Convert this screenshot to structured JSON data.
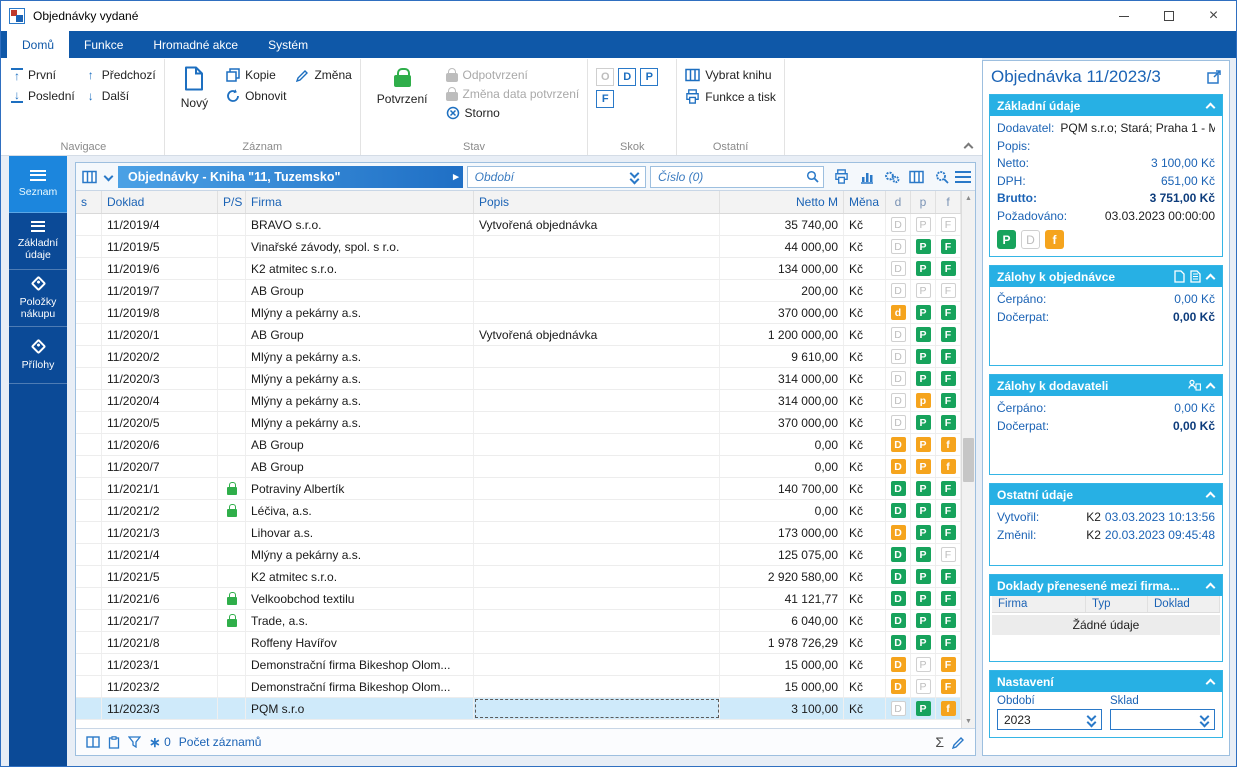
{
  "window": {
    "title": "Objednávky vydané"
  },
  "ribbon": {
    "tabs": [
      "Domů",
      "Funkce",
      "Hromadné akce",
      "Systém"
    ],
    "navigace": {
      "label": "Navigace",
      "prvni": "První",
      "posledni": "Poslední",
      "predchozi": "Předchozí",
      "dalsi": "Další"
    },
    "zaznam": {
      "label": "Záznam",
      "novy": "Nový",
      "kopie": "Kopie",
      "obnovit": "Obnovit",
      "zmena": "Změna"
    },
    "stav": {
      "label": "Stav",
      "potvrzeni": "Potvrzení",
      "odpotvrzeni": "Odpotvrzení",
      "zmena_data": "Změna data potvrzení",
      "storno": "Storno"
    },
    "skok": {
      "label": "Skok",
      "o": "O",
      "d": "D",
      "p": "P",
      "f": "F"
    },
    "ostatni": {
      "label": "Ostatní",
      "vybrat_knihu": "Vybrat knihu",
      "funkce_a_tisk": "Funkce a tisk"
    }
  },
  "sidebar": {
    "items": [
      {
        "label": "Seznam",
        "active": true
      },
      {
        "label": "Základní údaje"
      },
      {
        "label": "Položky nákupu"
      },
      {
        "label": "Přílohy"
      }
    ]
  },
  "toolbar": {
    "book_title": "Objednávky - Kniha \"11, Tuzemsko\"",
    "obdobi_placeholder": "Období",
    "cislo_placeholder": "Číslo (0)"
  },
  "table": {
    "columns": [
      "s",
      "Doklad",
      "P/S",
      "Firma",
      "Popis",
      "Netto M",
      "Měna",
      "d",
      "p",
      "f"
    ],
    "rows": [
      {
        "doklad": "11/2019/4",
        "lock": false,
        "firma": "BRAVO s.r.o.",
        "popis": "Vytvořená objednávka",
        "netto": "35 740,00",
        "mena": "Kč",
        "flags": [
          [
            "D",
            "gray"
          ],
          [
            "P",
            "gray"
          ],
          [
            "F",
            "gray"
          ]
        ]
      },
      {
        "doklad": "11/2019/5",
        "lock": false,
        "firma": "Vinařské závody, spol. s r.o.",
        "popis": "",
        "netto": "44 000,00",
        "mena": "Kč",
        "flags": [
          [
            "D",
            "gray"
          ],
          [
            "P",
            "green"
          ],
          [
            "F",
            "green"
          ]
        ]
      },
      {
        "doklad": "11/2019/6",
        "lock": false,
        "firma": "K2 atmitec s.r.o.",
        "popis": "",
        "netto": "134 000,00",
        "mena": "Kč",
        "flags": [
          [
            "D",
            "gray"
          ],
          [
            "P",
            "green"
          ],
          [
            "F",
            "green"
          ]
        ]
      },
      {
        "doklad": "11/2019/7",
        "lock": false,
        "firma": "AB Group",
        "popis": "",
        "netto": "200,00",
        "mena": "Kč",
        "flags": [
          [
            "D",
            "gray"
          ],
          [
            "P",
            "gray"
          ],
          [
            "F",
            "gray"
          ]
        ]
      },
      {
        "doklad": "11/2019/8",
        "lock": false,
        "firma": "Mlýny a pekárny a.s.",
        "popis": "",
        "netto": "370 000,00",
        "mena": "Kč",
        "flags": [
          [
            "d",
            "orange"
          ],
          [
            "P",
            "green"
          ],
          [
            "F",
            "green"
          ]
        ]
      },
      {
        "doklad": "11/2020/1",
        "lock": false,
        "firma": "AB Group",
        "popis": "Vytvořená objednávka",
        "netto": "1 200 000,00",
        "mena": "Kč",
        "flags": [
          [
            "D",
            "gray"
          ],
          [
            "P",
            "green"
          ],
          [
            "F",
            "green"
          ]
        ]
      },
      {
        "doklad": "11/2020/2",
        "lock": false,
        "firma": "Mlýny a pekárny a.s.",
        "popis": "",
        "netto": "9 610,00",
        "mena": "Kč",
        "flags": [
          [
            "D",
            "gray"
          ],
          [
            "P",
            "green"
          ],
          [
            "F",
            "green"
          ]
        ]
      },
      {
        "doklad": "11/2020/3",
        "lock": false,
        "firma": "Mlýny a pekárny a.s.",
        "popis": "",
        "netto": "314 000,00",
        "mena": "Kč",
        "flags": [
          [
            "D",
            "gray"
          ],
          [
            "P",
            "green"
          ],
          [
            "F",
            "green"
          ]
        ]
      },
      {
        "doklad": "11/2020/4",
        "lock": false,
        "firma": "Mlýny a pekárny a.s.",
        "popis": "",
        "netto": "314 000,00",
        "mena": "Kč",
        "flags": [
          [
            "D",
            "gray"
          ],
          [
            "p",
            "orange"
          ],
          [
            "F",
            "green"
          ]
        ]
      },
      {
        "doklad": "11/2020/5",
        "lock": false,
        "firma": "Mlýny a pekárny a.s.",
        "popis": "",
        "netto": "370 000,00",
        "mena": "Kč",
        "flags": [
          [
            "D",
            "gray"
          ],
          [
            "P",
            "green"
          ],
          [
            "F",
            "green"
          ]
        ]
      },
      {
        "doklad": "11/2020/6",
        "lock": false,
        "firma": "AB Group",
        "popis": "",
        "netto": "0,00",
        "mena": "Kč",
        "flags": [
          [
            "D",
            "orange"
          ],
          [
            "P",
            "orange"
          ],
          [
            "f",
            "orange"
          ]
        ]
      },
      {
        "doklad": "11/2020/7",
        "lock": false,
        "firma": "AB Group",
        "popis": "",
        "netto": "0,00",
        "mena": "Kč",
        "flags": [
          [
            "D",
            "orange"
          ],
          [
            "P",
            "orange"
          ],
          [
            "f",
            "orange"
          ]
        ]
      },
      {
        "doklad": "11/2021/1",
        "lock": true,
        "firma": "Potraviny Albertík",
        "popis": "",
        "netto": "140 700,00",
        "mena": "Kč",
        "flags": [
          [
            "D",
            "green"
          ],
          [
            "P",
            "green"
          ],
          [
            "F",
            "green"
          ]
        ]
      },
      {
        "doklad": "11/2021/2",
        "lock": true,
        "firma": "Léčiva, a.s.",
        "popis": "",
        "netto": "0,00",
        "mena": "Kč",
        "flags": [
          [
            "D",
            "green"
          ],
          [
            "P",
            "green"
          ],
          [
            "F",
            "green"
          ]
        ]
      },
      {
        "doklad": "11/2021/3",
        "lock": false,
        "firma": "Lihovar a.s.",
        "popis": "",
        "netto": "173 000,00",
        "mena": "Kč",
        "flags": [
          [
            "D",
            "orange"
          ],
          [
            "P",
            "green"
          ],
          [
            "F",
            "green"
          ]
        ]
      },
      {
        "doklad": "11/2021/4",
        "lock": false,
        "firma": "Mlýny a pekárny a.s.",
        "popis": "",
        "netto": "125 075,00",
        "mena": "Kč",
        "flags": [
          [
            "D",
            "green"
          ],
          [
            "P",
            "green"
          ],
          [
            "F",
            "gray"
          ]
        ]
      },
      {
        "doklad": "11/2021/5",
        "lock": false,
        "firma": "K2 atmitec s.r.o.",
        "popis": "",
        "netto": "2 920 580,00",
        "mena": "Kč",
        "flags": [
          [
            "D",
            "green"
          ],
          [
            "P",
            "green"
          ],
          [
            "F",
            "green"
          ]
        ]
      },
      {
        "doklad": "11/2021/6",
        "lock": true,
        "firma": "Velkoobchod textilu",
        "popis": "",
        "netto": "41 121,77",
        "mena": "Kč",
        "flags": [
          [
            "D",
            "green"
          ],
          [
            "P",
            "green"
          ],
          [
            "F",
            "green"
          ]
        ]
      },
      {
        "doklad": "11/2021/7",
        "lock": true,
        "firma": "Trade, a.s.",
        "popis": "",
        "netto": "6 040,00",
        "mena": "Kč",
        "flags": [
          [
            "D",
            "green"
          ],
          [
            "P",
            "green"
          ],
          [
            "F",
            "green"
          ]
        ]
      },
      {
        "doklad": "11/2021/8",
        "lock": false,
        "firma": "Roffeny Havířov",
        "popis": "",
        "netto": "1 978 726,29",
        "mena": "Kč",
        "flags": [
          [
            "D",
            "green"
          ],
          [
            "P",
            "green"
          ],
          [
            "F",
            "green"
          ]
        ]
      },
      {
        "doklad": "11/2023/1",
        "lock": false,
        "firma": "Demonstrační firma Bikeshop Olom...",
        "popis": "",
        "netto": "15 000,00",
        "mena": "Kč",
        "flags": [
          [
            "D",
            "orange"
          ],
          [
            "P",
            "gray"
          ],
          [
            "F",
            "orange"
          ]
        ]
      },
      {
        "doklad": "11/2023/2",
        "lock": false,
        "firma": "Demonstrační firma Bikeshop Olom...",
        "popis": "",
        "netto": "15 000,00",
        "mena": "Kč",
        "flags": [
          [
            "D",
            "orange"
          ],
          [
            "P",
            "gray"
          ],
          [
            "F",
            "orange"
          ]
        ]
      },
      {
        "doklad": "11/2023/3",
        "lock": false,
        "selected": true,
        "firma": "PQM s.r.o",
        "popis": "",
        "netto": "3 100,00",
        "mena": "Kč",
        "flags": [
          [
            "D",
            "gray"
          ],
          [
            "P",
            "green"
          ],
          [
            "f",
            "orange"
          ]
        ]
      }
    ]
  },
  "statusbar": {
    "refresh_count": "0",
    "count_label": "Počet záznamů"
  },
  "right_panel": {
    "title": "Objednávka 11/2023/3",
    "zakladni": {
      "title": "Základní údaje",
      "dodavatel_label": "Dodavatel:",
      "dodavatel": "PQM s.r.o; Stará; Praha 1 - M...",
      "popis_label": "Popis:",
      "popis": "",
      "netto_label": "Netto:",
      "netto": "3 100,00 Kč",
      "dph_label": "DPH:",
      "dph": "651,00 Kč",
      "brutto_label": "Brutto:",
      "brutto": "3 751,00 Kč",
      "pozadovano_label": "Požadováno:",
      "pozadovano": "03.03.2023 00:00:00",
      "badges": [
        [
          "P",
          "green"
        ],
        [
          "D",
          "gray"
        ],
        [
          "f",
          "orange"
        ]
      ]
    },
    "zalohy_objednavka": {
      "title": "Zálohy k objednávce",
      "cerpano_label": "Čerpáno:",
      "cerpano": "0,00 Kč",
      "docerpat_label": "Dočerpat:",
      "docerpat": "0,00 Kč"
    },
    "zalohy_dodavatel": {
      "title": "Zálohy k dodavateli",
      "cerpano_label": "Čerpáno:",
      "cerpano": "0,00 Kč",
      "docerpat_label": "Dočerpat:",
      "docerpat": "0,00 Kč"
    },
    "ostatni_udaje": {
      "title": "Ostatní údaje",
      "vytvoril_label": "Vytvořil:",
      "vytvoril_user": "K2",
      "vytvoril_time": "03.03.2023 10:13:56",
      "zmenil_label": "Změnil:",
      "zmenil_user": "K2",
      "zmenil_time": "20.03.2023 09:45:48"
    },
    "doklady": {
      "title": "Doklady přenesené mezi firma...",
      "columns": [
        "Firma",
        "Typ",
        "Doklad"
      ],
      "empty": "Žádné údaje"
    },
    "nastaveni": {
      "title": "Nastavení",
      "obdobi_label": "Období",
      "obdobi_value": "2023",
      "sklad_label": "Sklad",
      "sklad_value": ""
    }
  }
}
